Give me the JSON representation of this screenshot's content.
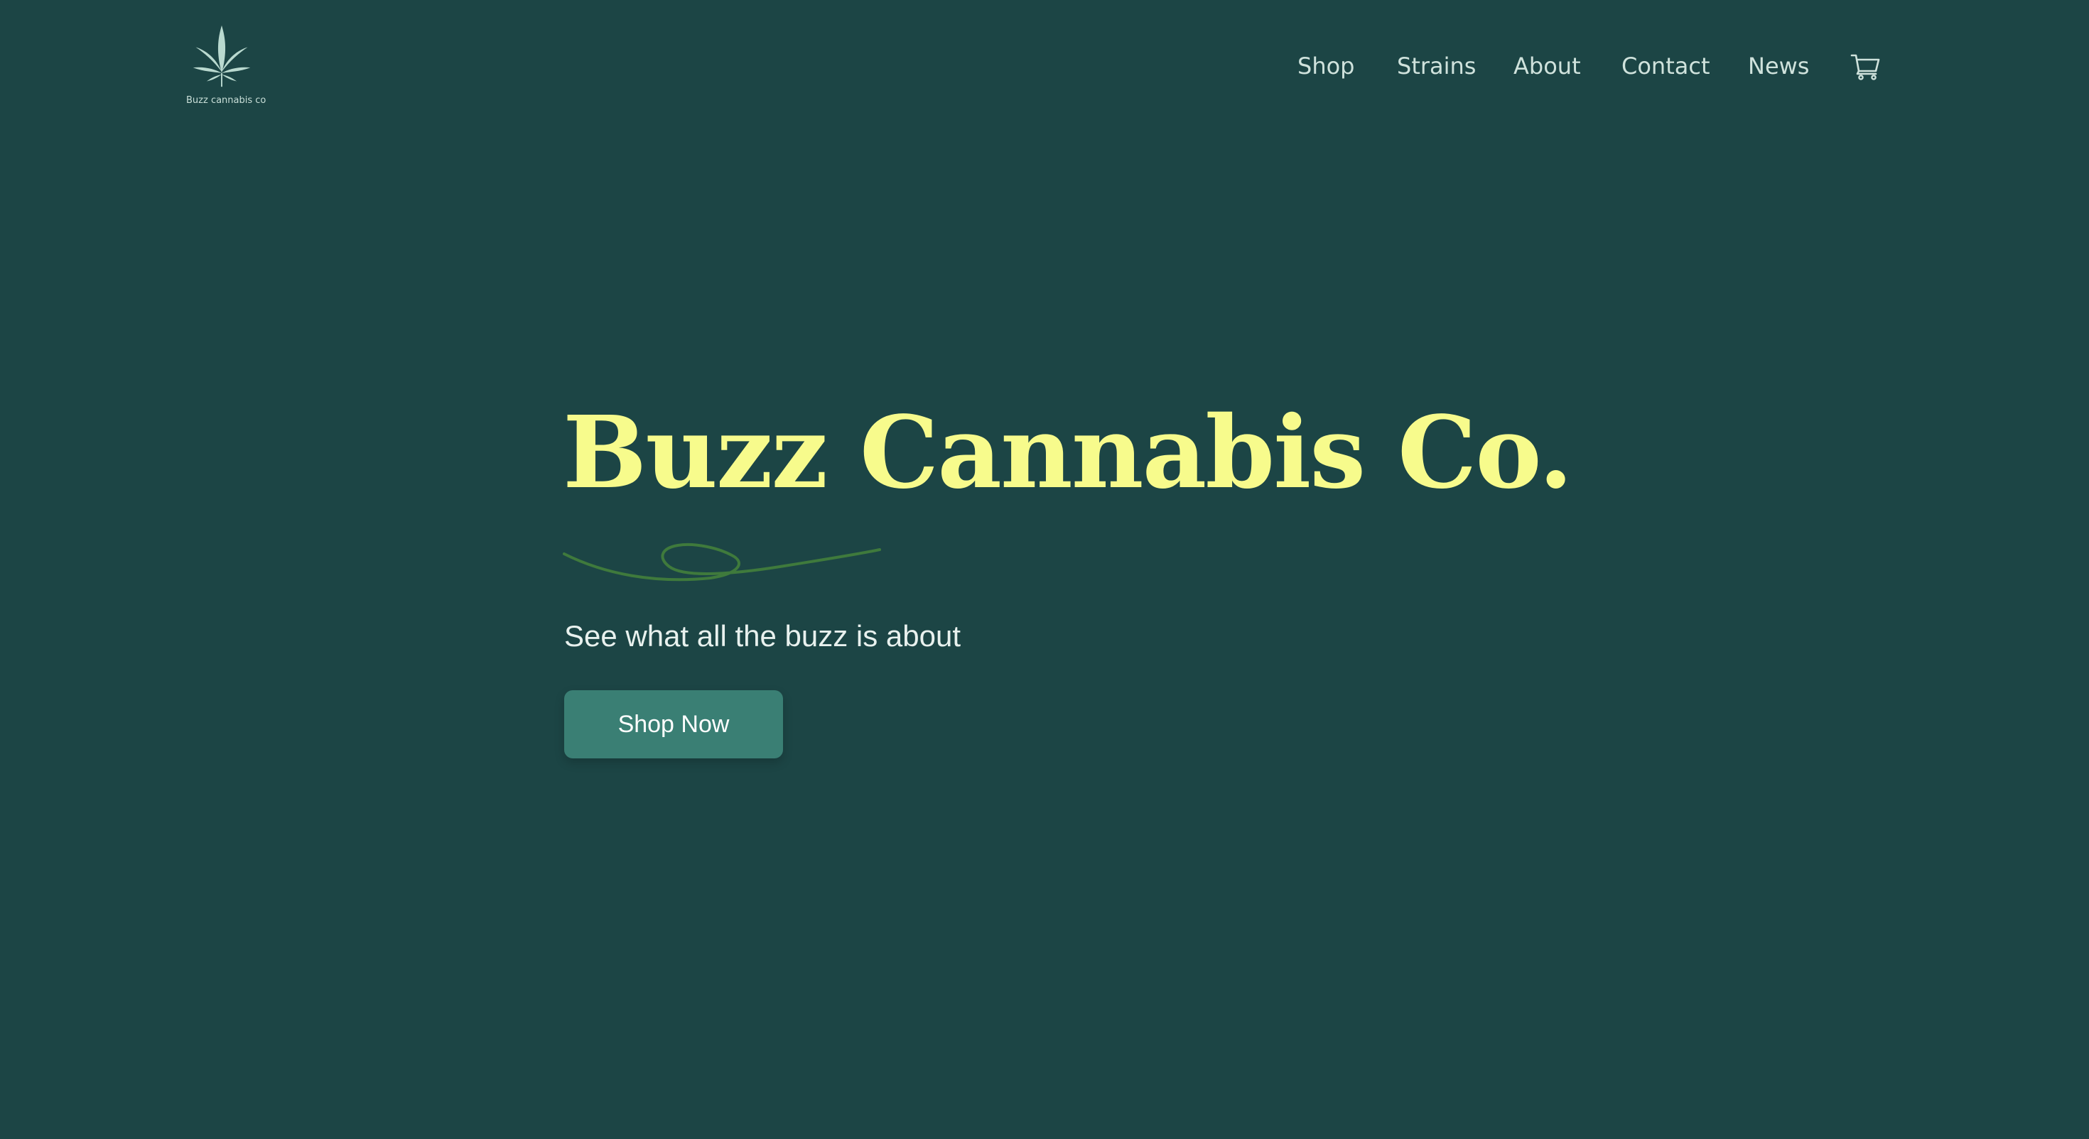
{
  "header": {
    "logo": {
      "text": "Buzz cannabis co",
      "icon": "cannabis-leaf-icon"
    },
    "nav": [
      {
        "label": "Shop"
      },
      {
        "label": "Strains"
      },
      {
        "label": "About"
      },
      {
        "label": "Contact"
      },
      {
        "label": "News"
      }
    ],
    "cart_icon": "cart-icon"
  },
  "hero": {
    "title": "Buzz Cannabis Co.",
    "subtitle": "See what all the buzz is about",
    "cta_label": "Shop Now"
  },
  "colors": {
    "background": "#1c4545",
    "title": "#f7fb8c",
    "nav_text": "#cfe2dc",
    "button": "#3a7f74",
    "squiggle": "#3f7a3c",
    "logo": "#b9d9cf"
  }
}
